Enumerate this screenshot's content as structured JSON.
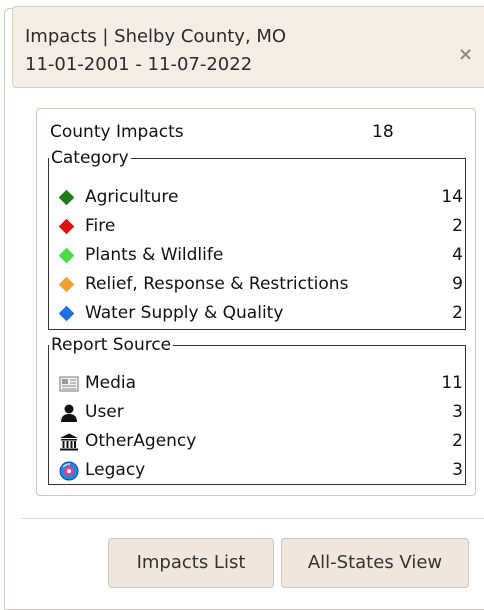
{
  "header": {
    "title_line1": "Impacts | Shelby County, MO",
    "title_line2": "11-01-2001 - 11-07-2022",
    "close_label": "×"
  },
  "summary": {
    "label": "County Impacts",
    "count": "18"
  },
  "category": {
    "legend": "Category",
    "items": [
      {
        "label": "Agriculture",
        "count": "14",
        "color": "#1e7b1e"
      },
      {
        "label": "Fire",
        "count": "2",
        "color": "#e01010"
      },
      {
        "label": "Plants & Wildlife",
        "count": "4",
        "color": "#4cd94c"
      },
      {
        "label": "Relief, Response & Restrictions",
        "count": "9",
        "color": "#f0a030"
      },
      {
        "label": "Water Supply & Quality",
        "count": "2",
        "color": "#1f6fe0"
      }
    ]
  },
  "source": {
    "legend": "Report Source",
    "items": [
      {
        "label": "Media",
        "count": "11",
        "icon": "newspaper-icon"
      },
      {
        "label": "User",
        "count": "3",
        "icon": "user-icon"
      },
      {
        "label": "OtherAgency",
        "count": "2",
        "icon": "building-icon"
      },
      {
        "label": "Legacy",
        "count": "3",
        "icon": "disc-icon"
      }
    ]
  },
  "buttons": {
    "impacts_list": "Impacts List",
    "all_states": "All-States View"
  }
}
